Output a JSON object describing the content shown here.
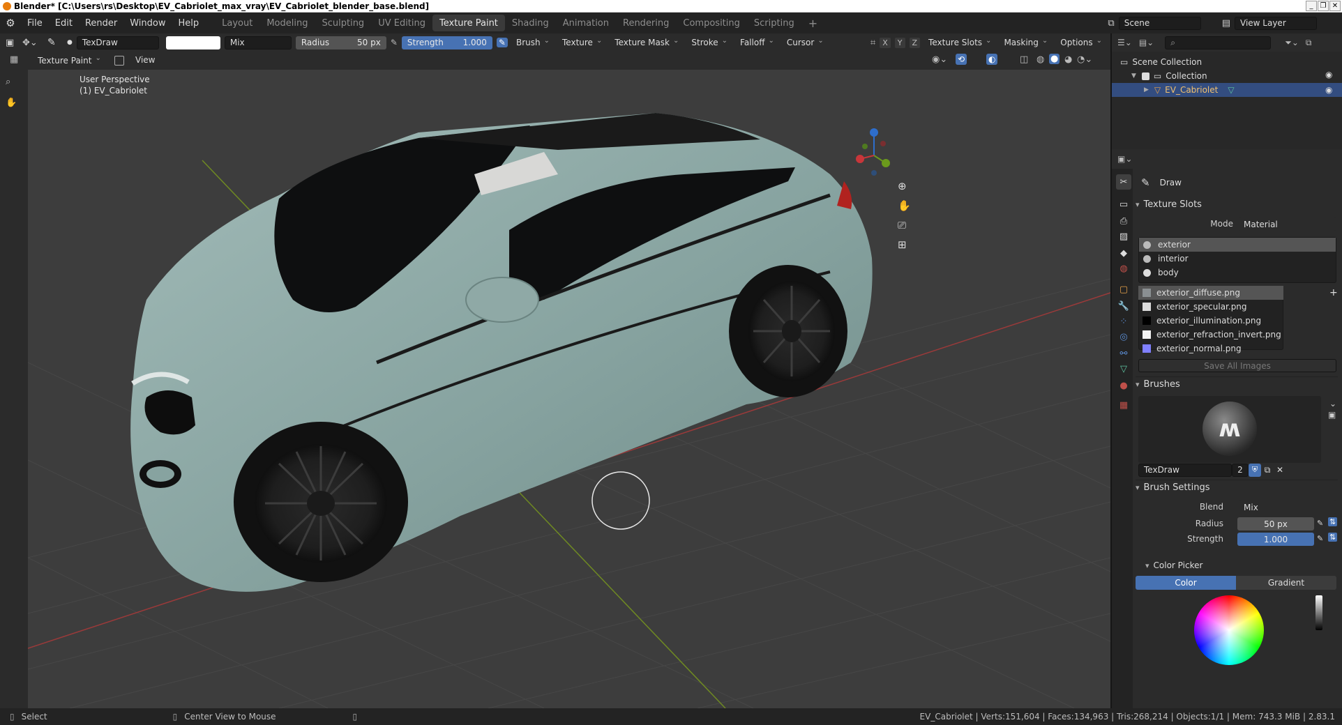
{
  "titlebar": {
    "title": "Blender* [C:\\Users\\rs\\Desktop\\EV_Cabriolet_max_vray\\EV_Cabriolet_blender_base.blend]",
    "minimize": "_",
    "restore": "❐",
    "close": "✕"
  },
  "menu": [
    "File",
    "Edit",
    "Render",
    "Window",
    "Help"
  ],
  "workspaces": [
    "Layout",
    "Modeling",
    "Sculpting",
    "UV Editing",
    "Texture Paint",
    "Shading",
    "Animation",
    "Rendering",
    "Compositing",
    "Scripting"
  ],
  "active_workspace": "Texture Paint",
  "add_workspace": "+",
  "scene": {
    "name": "Scene",
    "view_layer": "View Layer"
  },
  "header": {
    "brush_name": "TexDraw",
    "blend_mode": "Mix",
    "radius_label": "Radius",
    "radius_value": "50 px",
    "strength_label": "Strength",
    "strength_value": "1.000",
    "dropdowns": [
      "Brush",
      "Texture",
      "Texture Mask",
      "Stroke",
      "Falloff",
      "Cursor"
    ],
    "axes": [
      "X",
      "Y",
      "Z"
    ],
    "right_dropdowns": [
      "Texture Slots",
      "Masking",
      "Options"
    ],
    "mode": "Texture Paint",
    "view": "View"
  },
  "viewport": {
    "perspective": "User Perspective",
    "object": "(1) EV_Cabriolet",
    "gizmo": {
      "x": "X",
      "y": "Y",
      "z": "Z"
    },
    "colors": {
      "car_body": "#87a3a0",
      "glass": "#0e0f10",
      "grid": "#474747",
      "x_axis": "#9b3a3a",
      "y_axis": "#6f8a22"
    }
  },
  "outliner": {
    "search_placeholder": "",
    "scene_collection": "Scene Collection",
    "collection": "Collection",
    "object": "EV_Cabriolet"
  },
  "properties": {
    "tool": "Draw",
    "texture_slots": {
      "title": "Texture Slots",
      "mode_label": "Mode",
      "mode_value": "Material",
      "materials": [
        "exterior",
        "interior",
        "body"
      ],
      "images": [
        "exterior_diffuse.png",
        "exterior_specular.png",
        "exterior_illumination.png",
        "exterior_refraction_invert.png",
        "exterior_normal.png"
      ],
      "save_all": "Save All Images"
    },
    "brushes": {
      "title": "Brushes",
      "name": "TexDraw",
      "users": "2"
    },
    "brush_settings": {
      "title": "Brush Settings",
      "blend_label": "Blend",
      "blend_value": "Mix",
      "radius_label": "Radius",
      "radius_value": "50 px",
      "strength_label": "Strength",
      "strength_value": "1.000"
    },
    "color_picker": {
      "title": "Color Picker",
      "tab_color": "Color",
      "tab_gradient": "Gradient"
    }
  },
  "statusbar": {
    "select": "Select",
    "center_view": "Center View to Mouse",
    "stats": "EV_Cabriolet | Verts:151,604 | Faces:134,963 | Tris:268,214 | Objects:1/1 | Mem: 743.3 MiB | 2.83.1"
  }
}
